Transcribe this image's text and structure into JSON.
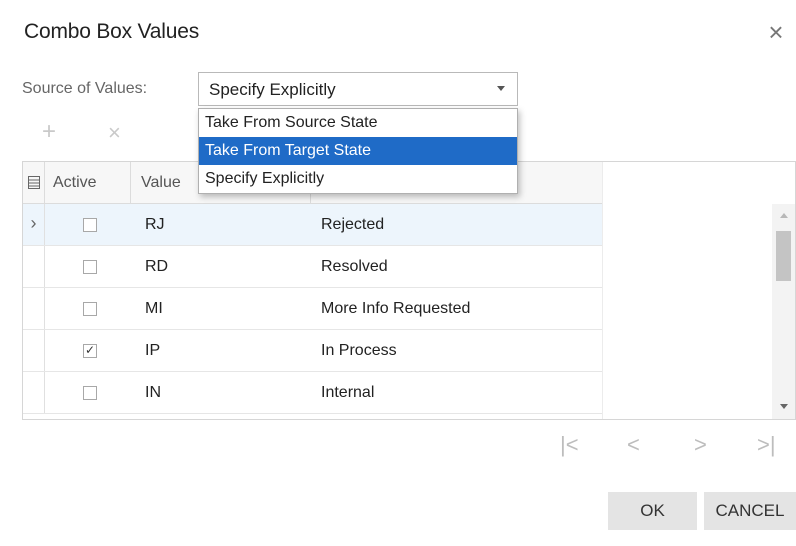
{
  "dialog": {
    "title": "Combo Box Values",
    "close_glyph": "×"
  },
  "source": {
    "label": "Source of Values:",
    "selected": "Specify Explicitly",
    "options": [
      "Take From Source State",
      "Take From Target State",
      "Specify Explicitly"
    ],
    "highlighted": "Take From Target State"
  },
  "toolbar": {
    "add_glyph": "+",
    "delete_glyph": "×"
  },
  "grid": {
    "columns": {
      "active": "Active",
      "value": "Value"
    },
    "rows": [
      {
        "active": false,
        "value": "RJ",
        "description": "Rejected",
        "current": true
      },
      {
        "active": false,
        "value": "RD",
        "description": "Resolved"
      },
      {
        "active": false,
        "value": "MI",
        "description": "More Info Requested"
      },
      {
        "active": true,
        "value": "IP",
        "description": "In Process"
      },
      {
        "active": false,
        "value": "IN",
        "description": "Internal"
      }
    ],
    "row_indicator_glyph": "›",
    "check_glyph": "✓",
    "columns_icon": "column-chooser-icon"
  },
  "pager": {
    "first": "|<",
    "prev": "<",
    "next": ">",
    "last": ">|"
  },
  "buttons": {
    "ok": "OK",
    "cancel": "CANCEL"
  },
  "colors": {
    "highlight": "#1f6bc7",
    "current_row": "#edf5fc"
  }
}
